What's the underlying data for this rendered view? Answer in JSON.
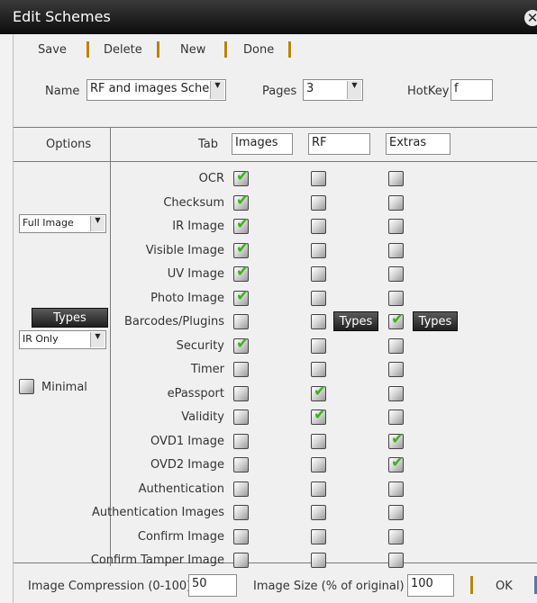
{
  "window": {
    "title": "Edit Schemes",
    "close_icon": "close-icon"
  },
  "toolbar": {
    "save": "Save",
    "delete": "Delete",
    "new": "New",
    "done": "Done"
  },
  "header": {
    "name_label": "Name",
    "name_value": "RF and images Sche",
    "pages_label": "Pages",
    "pages_value": "3",
    "hotkey_label": "HotKey",
    "hotkey_value": "f"
  },
  "table": {
    "options_header": "Options",
    "tab_label": "Tab",
    "tabs": [
      "Images",
      "RF",
      "Extras"
    ],
    "image_mode": "Full Image",
    "types_label": "Types",
    "types_mode": "IR Only",
    "minimal_label": "Minimal",
    "rows": [
      {
        "label": "OCR",
        "checked": [
          true,
          false,
          false
        ]
      },
      {
        "label": "Checksum",
        "checked": [
          true,
          false,
          false
        ]
      },
      {
        "label": "IR Image",
        "checked": [
          true,
          false,
          false
        ]
      },
      {
        "label": "Visible Image",
        "checked": [
          true,
          false,
          false
        ]
      },
      {
        "label": "UV Image",
        "checked": [
          true,
          false,
          false
        ]
      },
      {
        "label": "Photo Image",
        "checked": [
          true,
          false,
          false
        ]
      },
      {
        "label": "Barcodes/Plugins",
        "checked": [
          false,
          false,
          true
        ]
      },
      {
        "label": "Security",
        "checked": [
          true,
          false,
          false
        ]
      },
      {
        "label": "Timer",
        "checked": [
          false,
          false,
          false
        ]
      },
      {
        "label": "ePassport",
        "checked": [
          false,
          true,
          false
        ]
      },
      {
        "label": "Validity",
        "checked": [
          false,
          true,
          false
        ]
      },
      {
        "label": "OVD1 Image",
        "checked": [
          false,
          false,
          true
        ]
      },
      {
        "label": "OVD2 Image",
        "checked": [
          false,
          false,
          true
        ]
      },
      {
        "label": "Authentication",
        "checked": [
          false,
          false,
          false
        ]
      },
      {
        "label": "Authentication Images",
        "checked": [
          false,
          false,
          false
        ]
      },
      {
        "label": "Confirm Image",
        "checked": [
          false,
          false,
          false
        ]
      },
      {
        "label": "Confirm Tamper Image",
        "checked": [
          false,
          false,
          false
        ]
      }
    ],
    "row_types_label": "Types"
  },
  "footer": {
    "compression_label": "Image Compression (0-100)",
    "compression_value": "50",
    "size_label": "Image Size (% of original)",
    "size_value": "100",
    "ok": "OK"
  },
  "colors": {
    "accent": "#b8860b",
    "check": "#3cb21a",
    "titlebar": "#111111"
  }
}
